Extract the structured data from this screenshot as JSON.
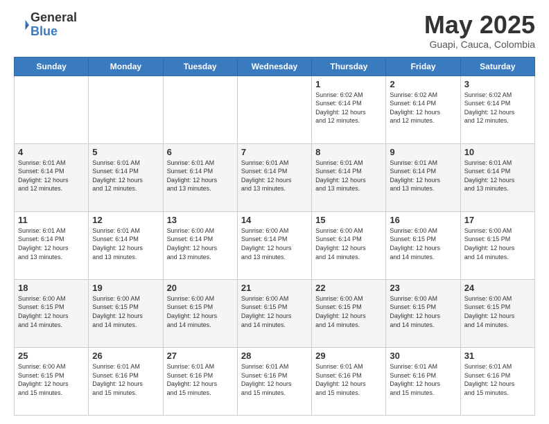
{
  "header": {
    "logo_line1": "General",
    "logo_line2": "Blue",
    "month": "May 2025",
    "location": "Guapi, Cauca, Colombia"
  },
  "days_of_week": [
    "Sunday",
    "Monday",
    "Tuesday",
    "Wednesday",
    "Thursday",
    "Friday",
    "Saturday"
  ],
  "weeks": [
    [
      {
        "day": "",
        "info": ""
      },
      {
        "day": "",
        "info": ""
      },
      {
        "day": "",
        "info": ""
      },
      {
        "day": "",
        "info": ""
      },
      {
        "day": "1",
        "info": "Sunrise: 6:02 AM\nSunset: 6:14 PM\nDaylight: 12 hours\nand 12 minutes."
      },
      {
        "day": "2",
        "info": "Sunrise: 6:02 AM\nSunset: 6:14 PM\nDaylight: 12 hours\nand 12 minutes."
      },
      {
        "day": "3",
        "info": "Sunrise: 6:02 AM\nSunset: 6:14 PM\nDaylight: 12 hours\nand 12 minutes."
      }
    ],
    [
      {
        "day": "4",
        "info": "Sunrise: 6:01 AM\nSunset: 6:14 PM\nDaylight: 12 hours\nand 12 minutes."
      },
      {
        "day": "5",
        "info": "Sunrise: 6:01 AM\nSunset: 6:14 PM\nDaylight: 12 hours\nand 12 minutes."
      },
      {
        "day": "6",
        "info": "Sunrise: 6:01 AM\nSunset: 6:14 PM\nDaylight: 12 hours\nand 13 minutes."
      },
      {
        "day": "7",
        "info": "Sunrise: 6:01 AM\nSunset: 6:14 PM\nDaylight: 12 hours\nand 13 minutes."
      },
      {
        "day": "8",
        "info": "Sunrise: 6:01 AM\nSunset: 6:14 PM\nDaylight: 12 hours\nand 13 minutes."
      },
      {
        "day": "9",
        "info": "Sunrise: 6:01 AM\nSunset: 6:14 PM\nDaylight: 12 hours\nand 13 minutes."
      },
      {
        "day": "10",
        "info": "Sunrise: 6:01 AM\nSunset: 6:14 PM\nDaylight: 12 hours\nand 13 minutes."
      }
    ],
    [
      {
        "day": "11",
        "info": "Sunrise: 6:01 AM\nSunset: 6:14 PM\nDaylight: 12 hours\nand 13 minutes."
      },
      {
        "day": "12",
        "info": "Sunrise: 6:01 AM\nSunset: 6:14 PM\nDaylight: 12 hours\nand 13 minutes."
      },
      {
        "day": "13",
        "info": "Sunrise: 6:00 AM\nSunset: 6:14 PM\nDaylight: 12 hours\nand 13 minutes."
      },
      {
        "day": "14",
        "info": "Sunrise: 6:00 AM\nSunset: 6:14 PM\nDaylight: 12 hours\nand 13 minutes."
      },
      {
        "day": "15",
        "info": "Sunrise: 6:00 AM\nSunset: 6:14 PM\nDaylight: 12 hours\nand 14 minutes."
      },
      {
        "day": "16",
        "info": "Sunrise: 6:00 AM\nSunset: 6:15 PM\nDaylight: 12 hours\nand 14 minutes."
      },
      {
        "day": "17",
        "info": "Sunrise: 6:00 AM\nSunset: 6:15 PM\nDaylight: 12 hours\nand 14 minutes."
      }
    ],
    [
      {
        "day": "18",
        "info": "Sunrise: 6:00 AM\nSunset: 6:15 PM\nDaylight: 12 hours\nand 14 minutes."
      },
      {
        "day": "19",
        "info": "Sunrise: 6:00 AM\nSunset: 6:15 PM\nDaylight: 12 hours\nand 14 minutes."
      },
      {
        "day": "20",
        "info": "Sunrise: 6:00 AM\nSunset: 6:15 PM\nDaylight: 12 hours\nand 14 minutes."
      },
      {
        "day": "21",
        "info": "Sunrise: 6:00 AM\nSunset: 6:15 PM\nDaylight: 12 hours\nand 14 minutes."
      },
      {
        "day": "22",
        "info": "Sunrise: 6:00 AM\nSunset: 6:15 PM\nDaylight: 12 hours\nand 14 minutes."
      },
      {
        "day": "23",
        "info": "Sunrise: 6:00 AM\nSunset: 6:15 PM\nDaylight: 12 hours\nand 14 minutes."
      },
      {
        "day": "24",
        "info": "Sunrise: 6:00 AM\nSunset: 6:15 PM\nDaylight: 12 hours\nand 14 minutes."
      }
    ],
    [
      {
        "day": "25",
        "info": "Sunrise: 6:00 AM\nSunset: 6:15 PM\nDaylight: 12 hours\nand 15 minutes."
      },
      {
        "day": "26",
        "info": "Sunrise: 6:01 AM\nSunset: 6:16 PM\nDaylight: 12 hours\nand 15 minutes."
      },
      {
        "day": "27",
        "info": "Sunrise: 6:01 AM\nSunset: 6:16 PM\nDaylight: 12 hours\nand 15 minutes."
      },
      {
        "day": "28",
        "info": "Sunrise: 6:01 AM\nSunset: 6:16 PM\nDaylight: 12 hours\nand 15 minutes."
      },
      {
        "day": "29",
        "info": "Sunrise: 6:01 AM\nSunset: 6:16 PM\nDaylight: 12 hours\nand 15 minutes."
      },
      {
        "day": "30",
        "info": "Sunrise: 6:01 AM\nSunset: 6:16 PM\nDaylight: 12 hours\nand 15 minutes."
      },
      {
        "day": "31",
        "info": "Sunrise: 6:01 AM\nSunset: 6:16 PM\nDaylight: 12 hours\nand 15 minutes."
      }
    ]
  ]
}
